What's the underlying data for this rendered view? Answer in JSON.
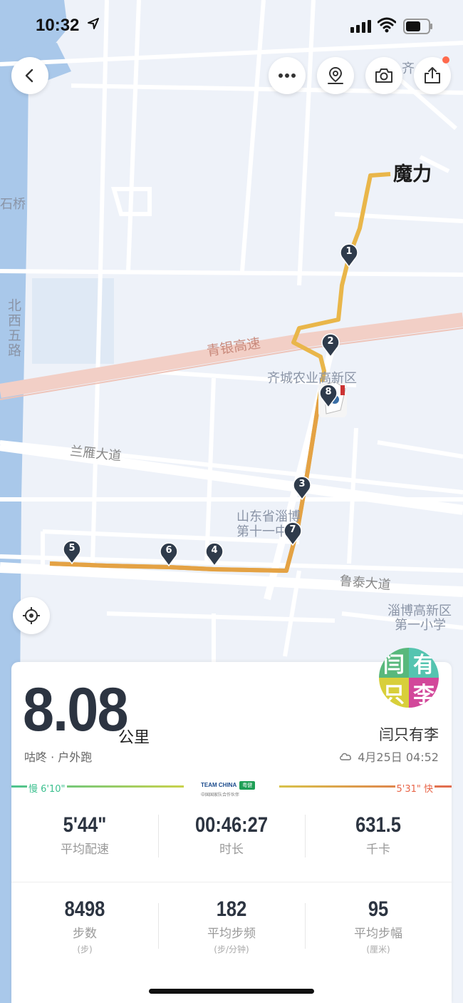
{
  "status_bar": {
    "time": "10:32"
  },
  "map": {
    "labels": {
      "qilu_top": "齐",
      "shiqiao": "石桥",
      "beixiwulu": "北西五路",
      "qingyin": "青银高速",
      "qicheng": "齐城农业高新区",
      "lanyan": "兰雁大道",
      "shandong": "山东省淄博",
      "shiyi": "第十一中学",
      "lutai": "鲁泰大道",
      "zibo1": "淄博高新区",
      "zibo2": "第一小学"
    },
    "end_label": "魔力",
    "km_markers": [
      "1",
      "2",
      "3",
      "4",
      "5",
      "6",
      "7",
      "8"
    ],
    "route_color": "#e9b64a"
  },
  "toolbar": {
    "back_icon": "back-icon",
    "more_icon": "more-icon",
    "location_pin_icon": "location-pin-icon",
    "camera_icon": "camera-icon",
    "share_icon": "share-icon",
    "locate_icon": "locate-icon"
  },
  "summary": {
    "distance": "8.08",
    "distance_unit": "公里",
    "activity": "咕咚 · 户外跑",
    "user_name": "闫只有李",
    "avatar_text": [
      "闫",
      "有",
      "只",
      "李"
    ],
    "date": "4月25日 04:52",
    "pace_slow": "慢 6'10\"",
    "pace_fast": "5'31\" 快",
    "team_logo": "TEAM CHINA",
    "team_tag": "粤健",
    "team_sub": "中国国家队合作伙伴"
  },
  "stats_row1": [
    {
      "value": "5'44\"",
      "label": "平均配速"
    },
    {
      "value": "00:46:27",
      "label": "时长"
    },
    {
      "value": "631.5",
      "label": "千卡"
    }
  ],
  "stats_row2": [
    {
      "value": "8498",
      "label": "步数",
      "unit": "(步)"
    },
    {
      "value": "182",
      "label": "平均步频",
      "unit": "(步/分钟)"
    },
    {
      "value": "95",
      "label": "平均步幅",
      "unit": "(厘米)"
    }
  ]
}
